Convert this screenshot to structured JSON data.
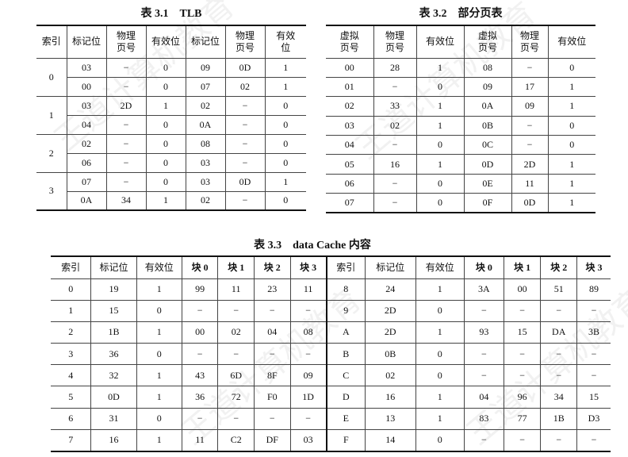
{
  "tlb": {
    "caption": "表 3.1    TLB",
    "headers": [
      "索引",
      "标记位",
      "物理页号",
      "有效位",
      "标记位",
      "物理页号",
      "有效位"
    ],
    "header_lines": [
      [
        "索引"
      ],
      [
        "标记位"
      ],
      [
        "物理",
        "页号"
      ],
      [
        "有效位"
      ],
      [
        "标记位"
      ],
      [
        "物理",
        "页号"
      ],
      [
        "有效",
        "位"
      ]
    ],
    "groups": [
      {
        "index": "0",
        "rows": [
          [
            "03",
            "−",
            "0",
            "09",
            "0D",
            "1"
          ],
          [
            "00",
            "−",
            "0",
            "07",
            "02",
            "1"
          ]
        ]
      },
      {
        "index": "1",
        "rows": [
          [
            "03",
            "2D",
            "1",
            "02",
            "−",
            "0"
          ],
          [
            "04",
            "−",
            "0",
            "0A",
            "−",
            "0"
          ]
        ]
      },
      {
        "index": "2",
        "rows": [
          [
            "02",
            "−",
            "0",
            "08",
            "−",
            "0"
          ],
          [
            "06",
            "−",
            "0",
            "03",
            "−",
            "0"
          ]
        ]
      },
      {
        "index": "3",
        "rows": [
          [
            "07",
            "−",
            "0",
            "03",
            "0D",
            "1"
          ],
          [
            "0A",
            "34",
            "1",
            "02",
            "−",
            "0"
          ]
        ]
      }
    ]
  },
  "page_table": {
    "caption": "表 3.2    部分页表",
    "header_lines": [
      [
        "虚拟",
        "页号"
      ],
      [
        "物理",
        "页号"
      ],
      [
        "有效位"
      ],
      [
        "虚拟",
        "页号"
      ],
      [
        "物理",
        "页号"
      ],
      [
        "有效位"
      ]
    ],
    "rows": [
      [
        "00",
        "28",
        "1",
        "08",
        "−",
        "0"
      ],
      [
        "01",
        "−",
        "0",
        "09",
        "17",
        "1"
      ],
      [
        "02",
        "33",
        "1",
        "0A",
        "09",
        "1"
      ],
      [
        "03",
        "02",
        "1",
        "0B",
        "−",
        "0"
      ],
      [
        "04",
        "−",
        "0",
        "0C",
        "−",
        "0"
      ],
      [
        "05",
        "16",
        "1",
        "0D",
        "2D",
        "1"
      ],
      [
        "06",
        "−",
        "0",
        "0E",
        "11",
        "1"
      ],
      [
        "07",
        "−",
        "0",
        "0F",
        "0D",
        "1"
      ]
    ]
  },
  "cache": {
    "caption": "表 3.3    data Cache 内容",
    "headers": [
      "索引",
      "标记位",
      "有效位",
      "块 0",
      "块 1",
      "块 2",
      "块 3",
      "索引",
      "标记位",
      "有效位",
      "块 0",
      "块 1",
      "块 2",
      "块 3"
    ],
    "rows": [
      [
        "0",
        "19",
        "1",
        "99",
        "11",
        "23",
        "11",
        "8",
        "24",
        "1",
        "3A",
        "00",
        "51",
        "89"
      ],
      [
        "1",
        "15",
        "0",
        "−",
        "−",
        "−",
        "−",
        "9",
        "2D",
        "0",
        "−",
        "−",
        "−",
        "−"
      ],
      [
        "2",
        "1B",
        "1",
        "00",
        "02",
        "04",
        "08",
        "A",
        "2D",
        "1",
        "93",
        "15",
        "DA",
        "3B"
      ],
      [
        "3",
        "36",
        "0",
        "−",
        "−",
        "−",
        "−",
        "B",
        "0B",
        "0",
        "−",
        "−",
        "−",
        "−"
      ],
      [
        "4",
        "32",
        "1",
        "43",
        "6D",
        "8F",
        "09",
        "C",
        "02",
        "0",
        "−",
        "−",
        "−",
        "−"
      ],
      [
        "5",
        "0D",
        "1",
        "36",
        "72",
        "F0",
        "1D",
        "D",
        "16",
        "1",
        "04",
        "96",
        "34",
        "15"
      ],
      [
        "6",
        "31",
        "0",
        "−",
        "−",
        "−",
        "−",
        "E",
        "13",
        "1",
        "83",
        "77",
        "1B",
        "D3"
      ],
      [
        "7",
        "16",
        "1",
        "11",
        "C2",
        "DF",
        "03",
        "F",
        "14",
        "0",
        "−",
        "−",
        "−",
        "−"
      ]
    ]
  }
}
